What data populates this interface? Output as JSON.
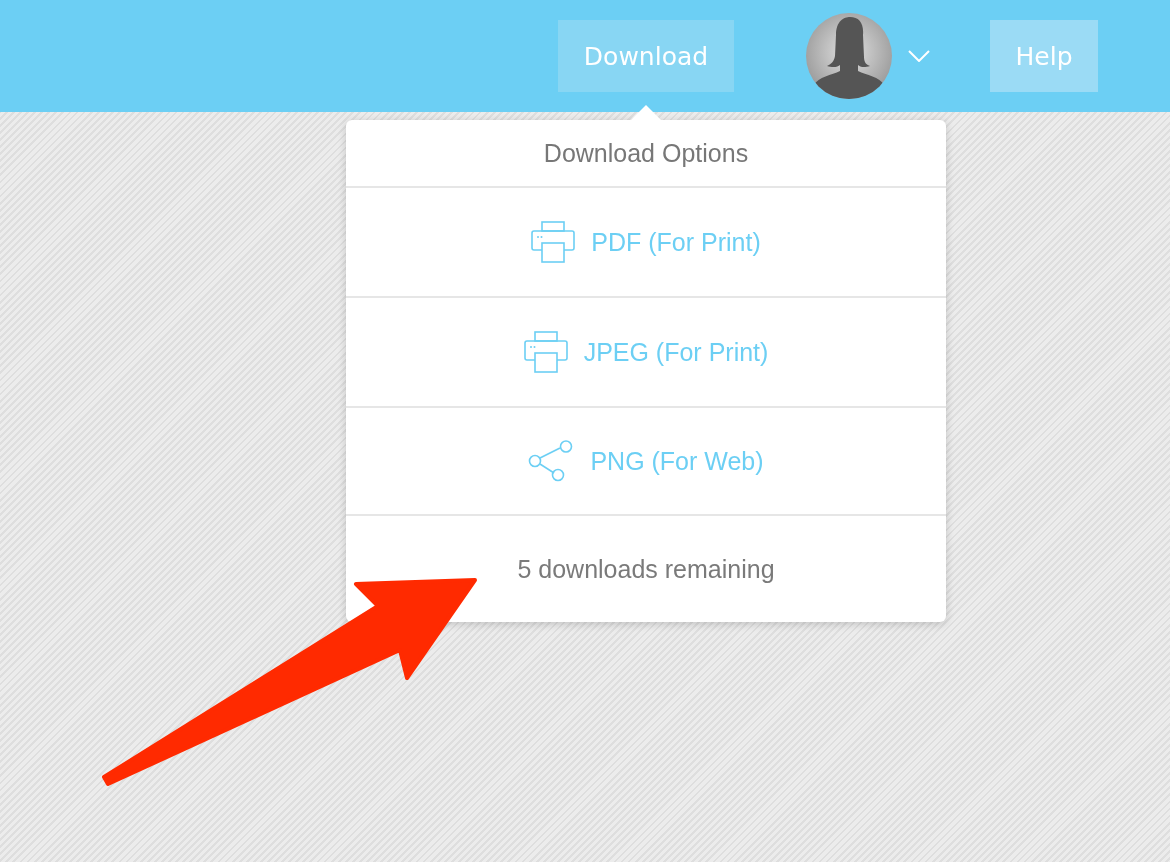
{
  "header": {
    "download_button": {
      "label": "Download",
      "expanded": true
    },
    "help_button": {
      "label": "Help"
    }
  },
  "download_menu": {
    "title": "Download Options",
    "options": [
      {
        "kind": "print",
        "label": "PDF (For Print)"
      },
      {
        "kind": "print",
        "label": "JPEG (For Print)"
      },
      {
        "kind": "share",
        "label": "PNG (For Web)"
      }
    ],
    "footer": "5 downloads remaining"
  }
}
